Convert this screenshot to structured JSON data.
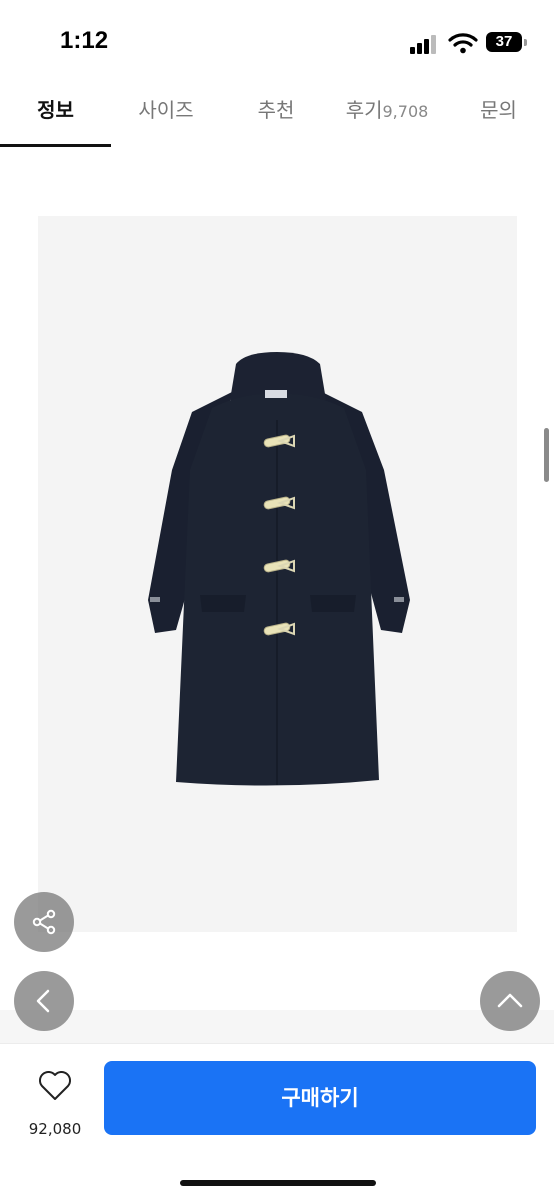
{
  "status_bar": {
    "time": "1:12",
    "battery": "37"
  },
  "tabs": [
    {
      "label": "정보",
      "active": true
    },
    {
      "label": "사이즈",
      "active": false
    },
    {
      "label": "추천",
      "active": false
    },
    {
      "label": "후기",
      "count": "9,708",
      "active": false
    },
    {
      "label": "문의",
      "active": false
    }
  ],
  "product": {
    "image_icon": "duffle-coat-image",
    "coat_color": "#1d2433"
  },
  "floating": {
    "share_icon": "share-icon",
    "back_icon": "chevron-left-icon",
    "top_icon": "chevron-up-icon"
  },
  "bottom_bar": {
    "like_count": "92,080",
    "buy_label": "구매하기",
    "accent": "#1a73f5"
  }
}
